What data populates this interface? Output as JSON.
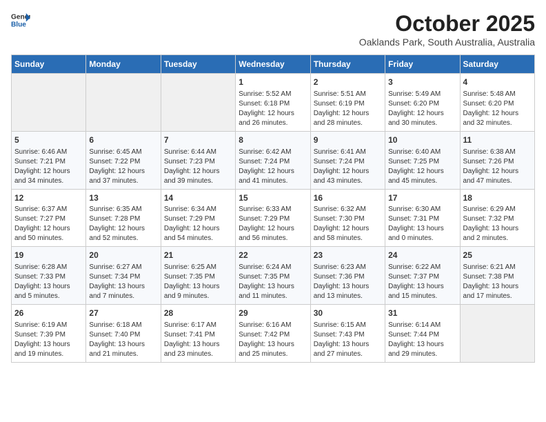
{
  "header": {
    "logo_line1": "General",
    "logo_line2": "Blue",
    "month": "October 2025",
    "location": "Oaklands Park, South Australia, Australia"
  },
  "weekdays": [
    "Sunday",
    "Monday",
    "Tuesday",
    "Wednesday",
    "Thursday",
    "Friday",
    "Saturday"
  ],
  "weeks": [
    [
      {
        "day": "",
        "info": ""
      },
      {
        "day": "",
        "info": ""
      },
      {
        "day": "",
        "info": ""
      },
      {
        "day": "1",
        "info": "Sunrise: 5:52 AM\nSunset: 6:18 PM\nDaylight: 12 hours\nand 26 minutes."
      },
      {
        "day": "2",
        "info": "Sunrise: 5:51 AM\nSunset: 6:19 PM\nDaylight: 12 hours\nand 28 minutes."
      },
      {
        "day": "3",
        "info": "Sunrise: 5:49 AM\nSunset: 6:20 PM\nDaylight: 12 hours\nand 30 minutes."
      },
      {
        "day": "4",
        "info": "Sunrise: 5:48 AM\nSunset: 6:20 PM\nDaylight: 12 hours\nand 32 minutes."
      }
    ],
    [
      {
        "day": "5",
        "info": "Sunrise: 6:46 AM\nSunset: 7:21 PM\nDaylight: 12 hours\nand 34 minutes."
      },
      {
        "day": "6",
        "info": "Sunrise: 6:45 AM\nSunset: 7:22 PM\nDaylight: 12 hours\nand 37 minutes."
      },
      {
        "day": "7",
        "info": "Sunrise: 6:44 AM\nSunset: 7:23 PM\nDaylight: 12 hours\nand 39 minutes."
      },
      {
        "day": "8",
        "info": "Sunrise: 6:42 AM\nSunset: 7:24 PM\nDaylight: 12 hours\nand 41 minutes."
      },
      {
        "day": "9",
        "info": "Sunrise: 6:41 AM\nSunset: 7:24 PM\nDaylight: 12 hours\nand 43 minutes."
      },
      {
        "day": "10",
        "info": "Sunrise: 6:40 AM\nSunset: 7:25 PM\nDaylight: 12 hours\nand 45 minutes."
      },
      {
        "day": "11",
        "info": "Sunrise: 6:38 AM\nSunset: 7:26 PM\nDaylight: 12 hours\nand 47 minutes."
      }
    ],
    [
      {
        "day": "12",
        "info": "Sunrise: 6:37 AM\nSunset: 7:27 PM\nDaylight: 12 hours\nand 50 minutes."
      },
      {
        "day": "13",
        "info": "Sunrise: 6:35 AM\nSunset: 7:28 PM\nDaylight: 12 hours\nand 52 minutes."
      },
      {
        "day": "14",
        "info": "Sunrise: 6:34 AM\nSunset: 7:29 PM\nDaylight: 12 hours\nand 54 minutes."
      },
      {
        "day": "15",
        "info": "Sunrise: 6:33 AM\nSunset: 7:29 PM\nDaylight: 12 hours\nand 56 minutes."
      },
      {
        "day": "16",
        "info": "Sunrise: 6:32 AM\nSunset: 7:30 PM\nDaylight: 12 hours\nand 58 minutes."
      },
      {
        "day": "17",
        "info": "Sunrise: 6:30 AM\nSunset: 7:31 PM\nDaylight: 13 hours\nand 0 minutes."
      },
      {
        "day": "18",
        "info": "Sunrise: 6:29 AM\nSunset: 7:32 PM\nDaylight: 13 hours\nand 2 minutes."
      }
    ],
    [
      {
        "day": "19",
        "info": "Sunrise: 6:28 AM\nSunset: 7:33 PM\nDaylight: 13 hours\nand 5 minutes."
      },
      {
        "day": "20",
        "info": "Sunrise: 6:27 AM\nSunset: 7:34 PM\nDaylight: 13 hours\nand 7 minutes."
      },
      {
        "day": "21",
        "info": "Sunrise: 6:25 AM\nSunset: 7:35 PM\nDaylight: 13 hours\nand 9 minutes."
      },
      {
        "day": "22",
        "info": "Sunrise: 6:24 AM\nSunset: 7:35 PM\nDaylight: 13 hours\nand 11 minutes."
      },
      {
        "day": "23",
        "info": "Sunrise: 6:23 AM\nSunset: 7:36 PM\nDaylight: 13 hours\nand 13 minutes."
      },
      {
        "day": "24",
        "info": "Sunrise: 6:22 AM\nSunset: 7:37 PM\nDaylight: 13 hours\nand 15 minutes."
      },
      {
        "day": "25",
        "info": "Sunrise: 6:21 AM\nSunset: 7:38 PM\nDaylight: 13 hours\nand 17 minutes."
      }
    ],
    [
      {
        "day": "26",
        "info": "Sunrise: 6:19 AM\nSunset: 7:39 PM\nDaylight: 13 hours\nand 19 minutes."
      },
      {
        "day": "27",
        "info": "Sunrise: 6:18 AM\nSunset: 7:40 PM\nDaylight: 13 hours\nand 21 minutes."
      },
      {
        "day": "28",
        "info": "Sunrise: 6:17 AM\nSunset: 7:41 PM\nDaylight: 13 hours\nand 23 minutes."
      },
      {
        "day": "29",
        "info": "Sunrise: 6:16 AM\nSunset: 7:42 PM\nDaylight: 13 hours\nand 25 minutes."
      },
      {
        "day": "30",
        "info": "Sunrise: 6:15 AM\nSunset: 7:43 PM\nDaylight: 13 hours\nand 27 minutes."
      },
      {
        "day": "31",
        "info": "Sunrise: 6:14 AM\nSunset: 7:44 PM\nDaylight: 13 hours\nand 29 minutes."
      },
      {
        "day": "",
        "info": ""
      }
    ]
  ]
}
